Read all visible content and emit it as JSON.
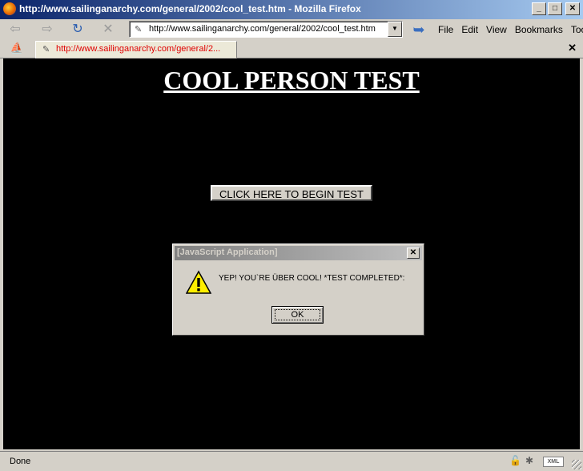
{
  "window": {
    "title": "http://www.sailinganarchy.com/general/2002/cool_test.htm - Mozilla Firefox",
    "minimize": "_",
    "maximize": "□",
    "close": "✕"
  },
  "toolbar": {
    "back_icon": "back-arrow-icon",
    "forward_icon": "forward-arrow-icon",
    "reload_icon": "reload-icon",
    "stop_icon": "stop-icon",
    "url": "http://www.sailinganarchy.com/general/2002/cool_test.htm",
    "go_icon": "go-arrow-icon"
  },
  "menu": {
    "file": "File",
    "edit": "Edit",
    "view": "View",
    "bookmarks": "Bookmarks",
    "tools": "Tools"
  },
  "tabs": [
    {
      "label": "http://www.sailinganarchy.com/general/2..."
    }
  ],
  "tabbar": {
    "close": "✕"
  },
  "page": {
    "title": "COOL PERSON TEST",
    "begin_button": "CLICK HERE TO BEGIN TEST"
  },
  "dialog": {
    "title": "[JavaScript Application]",
    "close": "✕",
    "message": "YEP! YOU`RE ÜBER COOL! *TEST COMPLETED*:",
    "ok_label": "OK"
  },
  "status": {
    "text": "Done",
    "xml_badge": "XML"
  },
  "colors": {
    "page_background": "#000000",
    "title_color": "#ffffff",
    "tab_url_color": "#e00000"
  }
}
